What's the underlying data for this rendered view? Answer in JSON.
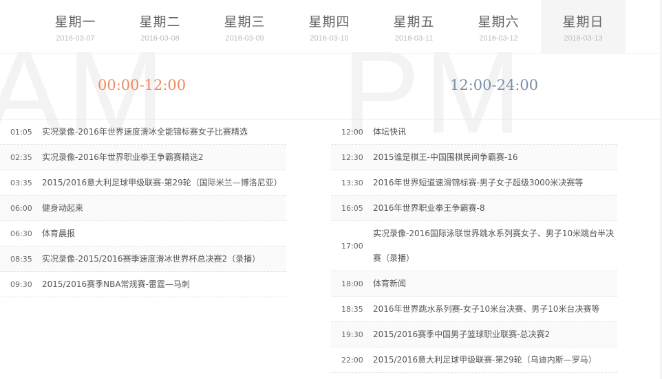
{
  "days": [
    {
      "day": "星期一",
      "date": "2016-03-07"
    },
    {
      "day": "星期二",
      "date": "2016-03-08"
    },
    {
      "day": "星期三",
      "date": "2016-03-09"
    },
    {
      "day": "星期四",
      "date": "2016-03-10"
    },
    {
      "day": "星期五",
      "date": "2016-03-11"
    },
    {
      "day": "星期六",
      "date": "2016-03-12"
    },
    {
      "day": "星期日",
      "date": "2016-03-13"
    }
  ],
  "active_day": "星期日",
  "am": {
    "bg": "AM",
    "range": "00:00-12:00",
    "items": [
      {
        "time": "01:05",
        "title": "实况录像-2016年世界速度滑冰全能锦标赛女子比赛精选"
      },
      {
        "time": "02:35",
        "title": "实况录像-2016年世界职业拳王争霸赛精选2"
      },
      {
        "time": "03:35",
        "title": "2015/2016意大利足球甲级联赛-第29轮（国际米兰—博洛尼亚）"
      },
      {
        "time": "06:00",
        "title": "健身动起来"
      },
      {
        "time": "06:30",
        "title": "体育晨报"
      },
      {
        "time": "08:35",
        "title": "实况录像-2015/2016赛季速度滑冰世界杯总决赛2（录播）"
      },
      {
        "time": "09:30",
        "title": "2015/2016赛季NBA常规赛-雷霆—马刺"
      }
    ]
  },
  "pm": {
    "bg": "PM",
    "range": "12:00-24:00",
    "items": [
      {
        "time": "12:00",
        "title": "体坛快讯"
      },
      {
        "time": "12:30",
        "title": "2015谁是棋王-中国围棋民间争霸赛-16"
      },
      {
        "time": "13:30",
        "title": "2016年世界短道速滑锦标赛-男子女子超级3000米决赛等"
      },
      {
        "time": "16:05",
        "title": "2016年世界职业拳王争霸赛-8"
      },
      {
        "time": "17:00",
        "title": "实况录像-2016国际泳联世界跳水系列赛女子、男子10米跳台半决赛（录播）"
      },
      {
        "time": "18:00",
        "title": "体育新闻"
      },
      {
        "time": "18:35",
        "title": "2016年世界跳水系列赛-女子10米台决赛、男子10米台决赛等"
      },
      {
        "time": "19:30",
        "title": "2015/2016赛季中国男子篮球职业联赛-总决赛2"
      },
      {
        "time": "22:00",
        "title": "2015/2016意大利足球甲级联赛-第29轮（乌迪内斯—罗马）"
      }
    ]
  }
}
